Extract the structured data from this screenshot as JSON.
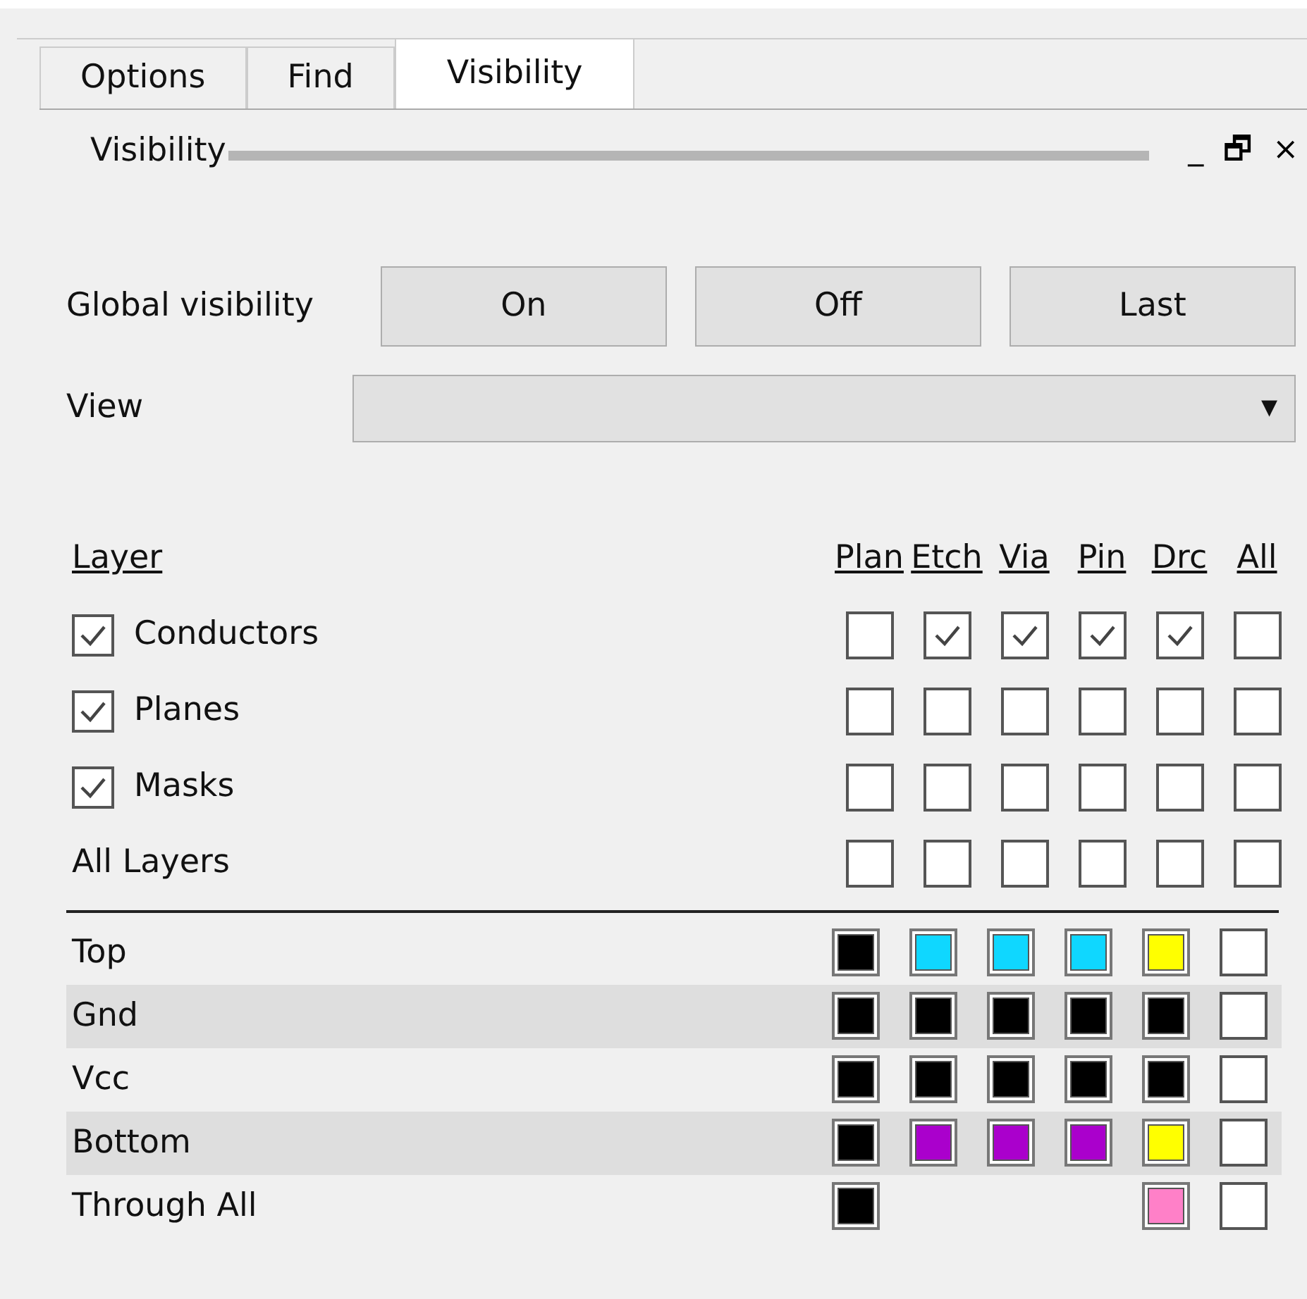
{
  "tabs": [
    {
      "label": "Options",
      "selected": false
    },
    {
      "label": "Find",
      "selected": false
    },
    {
      "label": "Visibility",
      "selected": true
    }
  ],
  "panel": {
    "title": "Visibility",
    "controls": [
      "_",
      "🗗",
      "×"
    ]
  },
  "global_visibility": {
    "label": "Global visibility",
    "buttons": [
      "On",
      "Off",
      "Last"
    ]
  },
  "view": {
    "label": "View",
    "caret": "▾"
  },
  "layers": {
    "header": "Layer",
    "columns": [
      "Plan",
      "Etch",
      "Via",
      "Pin",
      "Drc",
      "All"
    ],
    "rows": [
      {
        "label": "Conductors",
        "kind": "checkbox",
        "checked": true,
        "cells": [
          false,
          true,
          true,
          true,
          true,
          false
        ]
      },
      {
        "label": "Planes",
        "kind": "checkbox",
        "checked": true,
        "cells": [
          false,
          false,
          false,
          false,
          false,
          false
        ]
      },
      {
        "label": "Masks",
        "kind": "checkbox",
        "checked": true,
        "cells": [
          false,
          false,
          false,
          false,
          false,
          false
        ]
      },
      {
        "label": "All Layers",
        "kind": "plain",
        "cells": [
          false,
          false,
          false,
          false,
          false,
          false
        ]
      }
    ]
  },
  "colors": {
    "rows": [
      {
        "label": "Top",
        "cells": [
          {
            "kind": "swatch",
            "color": "#000000"
          },
          {
            "kind": "swatch",
            "color": "#0fd7ff"
          },
          {
            "kind": "swatch",
            "color": "#0fd7ff"
          },
          {
            "kind": "swatch",
            "color": "#0fd7ff"
          },
          {
            "kind": "swatch",
            "color": "#ffff00"
          },
          {
            "kind": "checkbox",
            "checked": false
          }
        ]
      },
      {
        "label": "Gnd",
        "cells": [
          {
            "kind": "swatch",
            "color": "#000000"
          },
          {
            "kind": "swatch",
            "color": "#000000"
          },
          {
            "kind": "swatch",
            "color": "#000000"
          },
          {
            "kind": "swatch",
            "color": "#000000"
          },
          {
            "kind": "swatch",
            "color": "#000000"
          },
          {
            "kind": "checkbox",
            "checked": false
          }
        ]
      },
      {
        "label": "Vcc",
        "cells": [
          {
            "kind": "swatch",
            "color": "#000000"
          },
          {
            "kind": "swatch",
            "color": "#000000"
          },
          {
            "kind": "swatch",
            "color": "#000000"
          },
          {
            "kind": "swatch",
            "color": "#000000"
          },
          {
            "kind": "swatch",
            "color": "#000000"
          },
          {
            "kind": "checkbox",
            "checked": false
          }
        ]
      },
      {
        "label": "Bottom",
        "cells": [
          {
            "kind": "swatch",
            "color": "#000000"
          },
          {
            "kind": "swatch",
            "color": "#aa00cc"
          },
          {
            "kind": "swatch",
            "color": "#aa00cc"
          },
          {
            "kind": "swatch",
            "color": "#aa00cc"
          },
          {
            "kind": "swatch",
            "color": "#ffff00"
          },
          {
            "kind": "checkbox",
            "checked": false
          }
        ]
      },
      {
        "label": "Through All",
        "cells": [
          {
            "kind": "swatch",
            "color": "#000000"
          },
          {
            "kind": "empty"
          },
          {
            "kind": "empty"
          },
          {
            "kind": "empty"
          },
          {
            "kind": "swatch",
            "color": "#ff80c8"
          },
          {
            "kind": "checkbox",
            "checked": false
          }
        ]
      }
    ]
  }
}
